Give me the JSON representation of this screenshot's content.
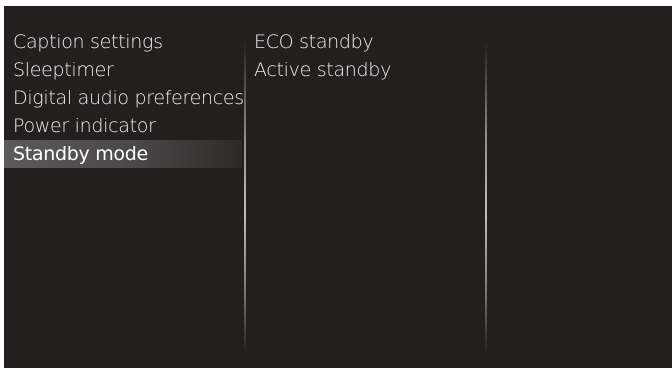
{
  "menu": {
    "items": [
      {
        "label": "Caption settings"
      },
      {
        "label": "Sleeptimer"
      },
      {
        "label": "Digital audio preferences"
      },
      {
        "label": "Power indicator"
      },
      {
        "label": "Standby mode",
        "selected": true
      }
    ]
  },
  "submenu": {
    "items": [
      {
        "label": "ECO standby"
      },
      {
        "label": "Active standby"
      }
    ]
  },
  "colors": {
    "background": "#231f1f",
    "text": "#ececec",
    "highlight": "#5b5959"
  }
}
